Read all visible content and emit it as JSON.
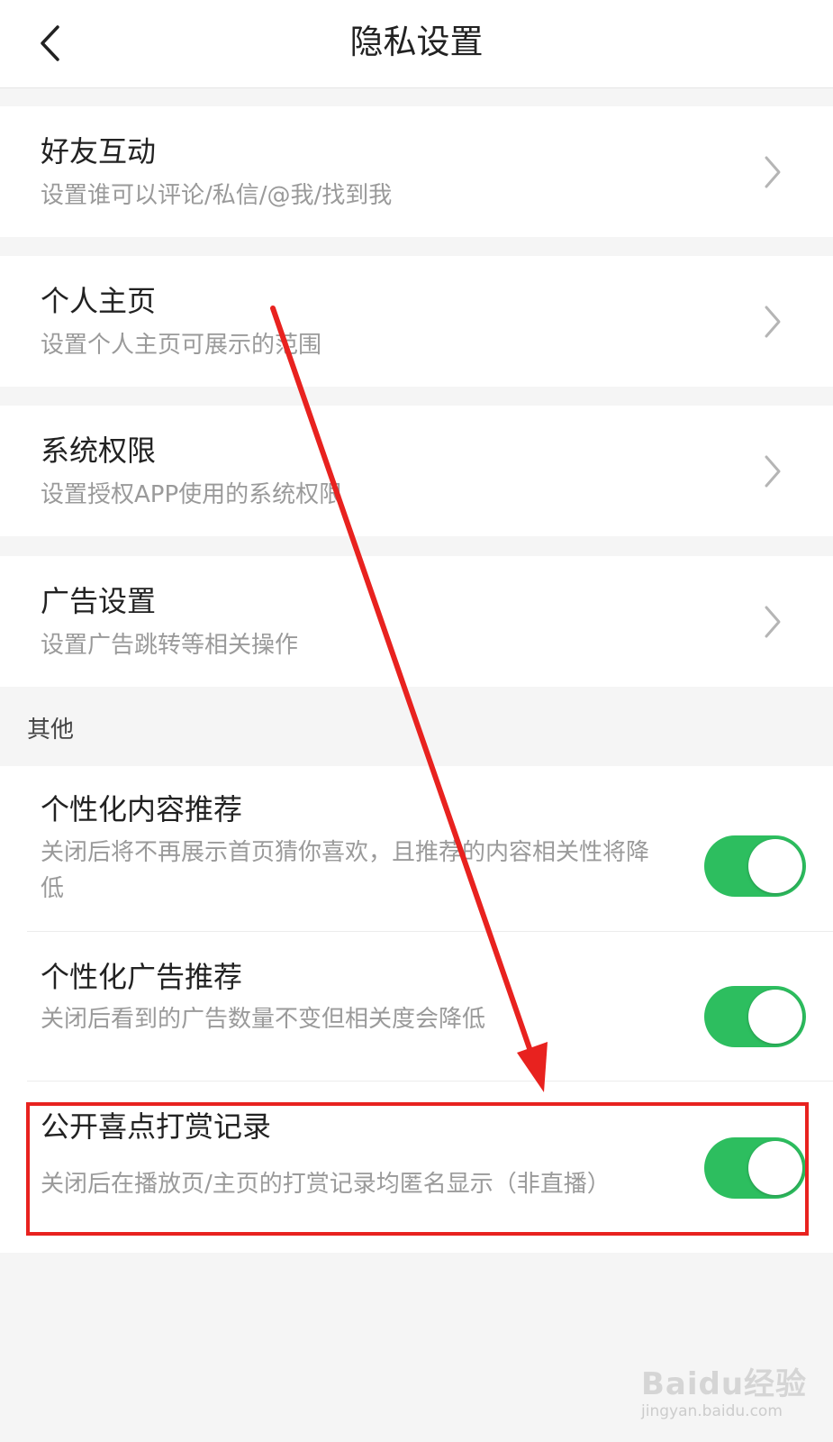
{
  "header": {
    "title": "隐私设置",
    "back_icon": "chevron-left-icon"
  },
  "nav_items": [
    {
      "title": "好友互动",
      "subtitle": "设置谁可以评论/私信/@我/找到我",
      "icon": "chevron-right-icon"
    },
    {
      "title": "个人主页",
      "subtitle": "设置个人主页可展示的范围",
      "icon": "chevron-right-icon"
    },
    {
      "title": "系统权限",
      "subtitle": "设置授权APP使用的系统权限",
      "icon": "chevron-right-icon"
    },
    {
      "title": "广告设置",
      "subtitle": "设置广告跳转等相关操作",
      "icon": "chevron-right-icon"
    }
  ],
  "other_section": {
    "label": "其他",
    "toggles": [
      {
        "title": "个性化内容推荐",
        "subtitle": "关闭后将不再展示首页猜你喜欢，且推荐的内容相关性将降低",
        "on": true
      },
      {
        "title": "个性化广告推荐",
        "subtitle": "关闭后看到的广告数量不变但相关度会降低",
        "on": true
      },
      {
        "title": "公开喜点打赏记录",
        "subtitle": "关闭后在播放页/主页的打赏记录均匿名显示（非直播）",
        "on": true
      }
    ]
  },
  "annotation": {
    "highlight_color": "#e8221f"
  },
  "colors": {
    "toggle_on": "#2dbe5f",
    "background": "#f5f5f5"
  },
  "watermark": {
    "brand": "Baidu经验",
    "url": "jingyan.baidu.com"
  }
}
